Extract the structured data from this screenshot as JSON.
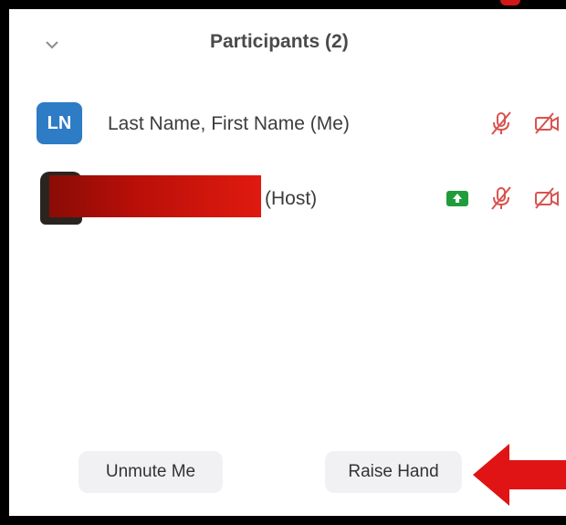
{
  "header": {
    "title": "Participants (2)",
    "collapse_icon": "chevron-down-icon"
  },
  "participants": [
    {
      "avatar_initials": "LN",
      "avatar_color": "#2e7bc6",
      "name": "Last Name, First Name (Me)",
      "icons": [
        "muted-mic-icon",
        "video-off-icon"
      ]
    },
    {
      "avatar": "photo",
      "name_redacted": true,
      "role": "(Host)",
      "icons": [
        "share-screen-icon",
        "muted-mic-icon",
        "video-off-icon"
      ]
    }
  ],
  "footer": {
    "unmute_label": "Unmute Me",
    "raise_hand_label": "Raise Hand"
  },
  "annotation": {
    "arrow_color": "#e01414",
    "redaction_color": "#d01010"
  },
  "colors": {
    "muted_icon": "#d9534f",
    "share_icon_bg": "#1f9d3a",
    "button_bg": "#f1f1f4"
  }
}
